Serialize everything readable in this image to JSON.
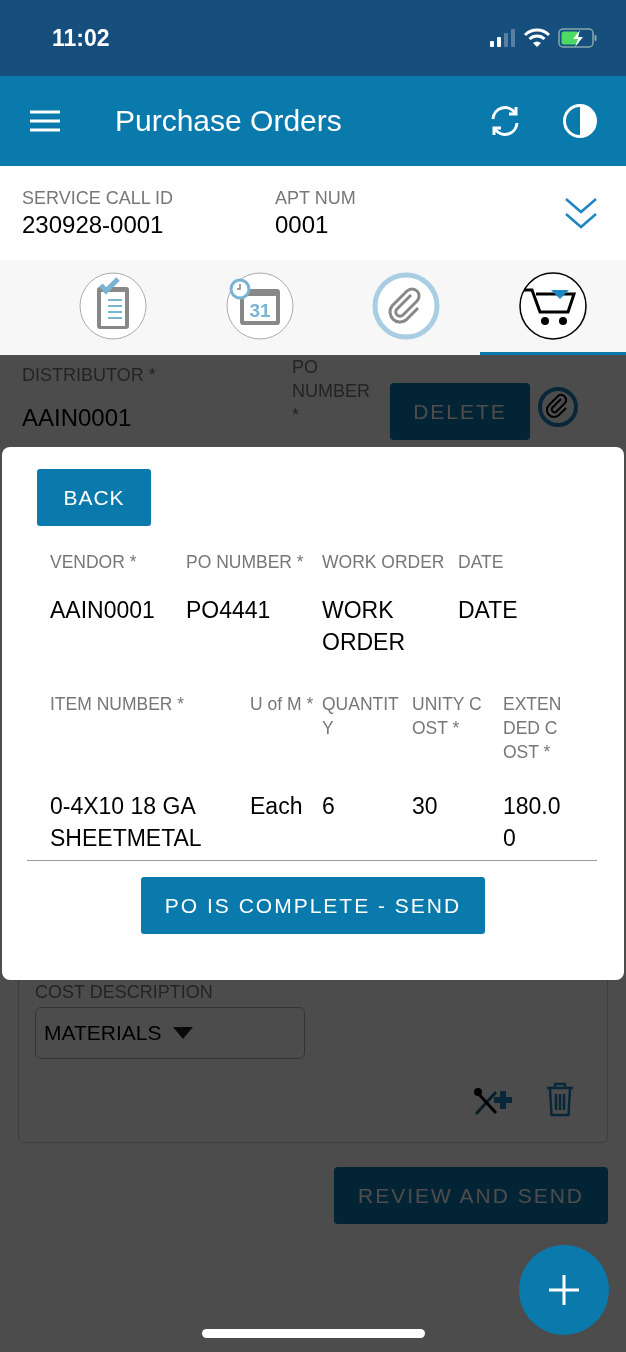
{
  "status_bar": {
    "time": "11:02"
  },
  "header": {
    "title": "Purchase Orders"
  },
  "service_call": {
    "fields": [
      {
        "label": "SERVICE CALL ID",
        "value": "230928-0001"
      },
      {
        "label": "APT NUM",
        "value": "0001"
      }
    ]
  },
  "tabs": [
    {
      "kind": "checklist",
      "selected": false
    },
    {
      "kind": "calendar",
      "selected": false,
      "day": "31"
    },
    {
      "kind": "attachment",
      "selected": false
    },
    {
      "kind": "cart",
      "selected": true
    }
  ],
  "po_form": {
    "distributor": {
      "label": "DISTRIBUTOR *",
      "value": "AAIN0001"
    },
    "po_number_label": "PO NUMBER *",
    "delete_button": "DELETE",
    "cost_description": {
      "label": "COST DESCRIPTION",
      "value": "MATERIALS"
    },
    "review_button": "REVIEW AND SEND"
  },
  "dialog": {
    "back_button": "BACK",
    "order_columns": [
      "VENDOR *",
      "PO NUMBER *",
      "WORK ORDER",
      "DATE"
    ],
    "order_values": [
      "AAIN0001",
      "PO4441",
      "WORK ORDER",
      "DATE"
    ],
    "item_columns": [
      "ITEM NUMBER *",
      "U of M *",
      "QUANTITY",
      "UNITY COST *",
      "EXTENDED COST *"
    ],
    "item_values": [
      "0-4X10 18 GA SHEETMETAL",
      "Each",
      "6",
      "30",
      "180.00"
    ],
    "send_button": "PO IS COMPLETE - SEND"
  }
}
